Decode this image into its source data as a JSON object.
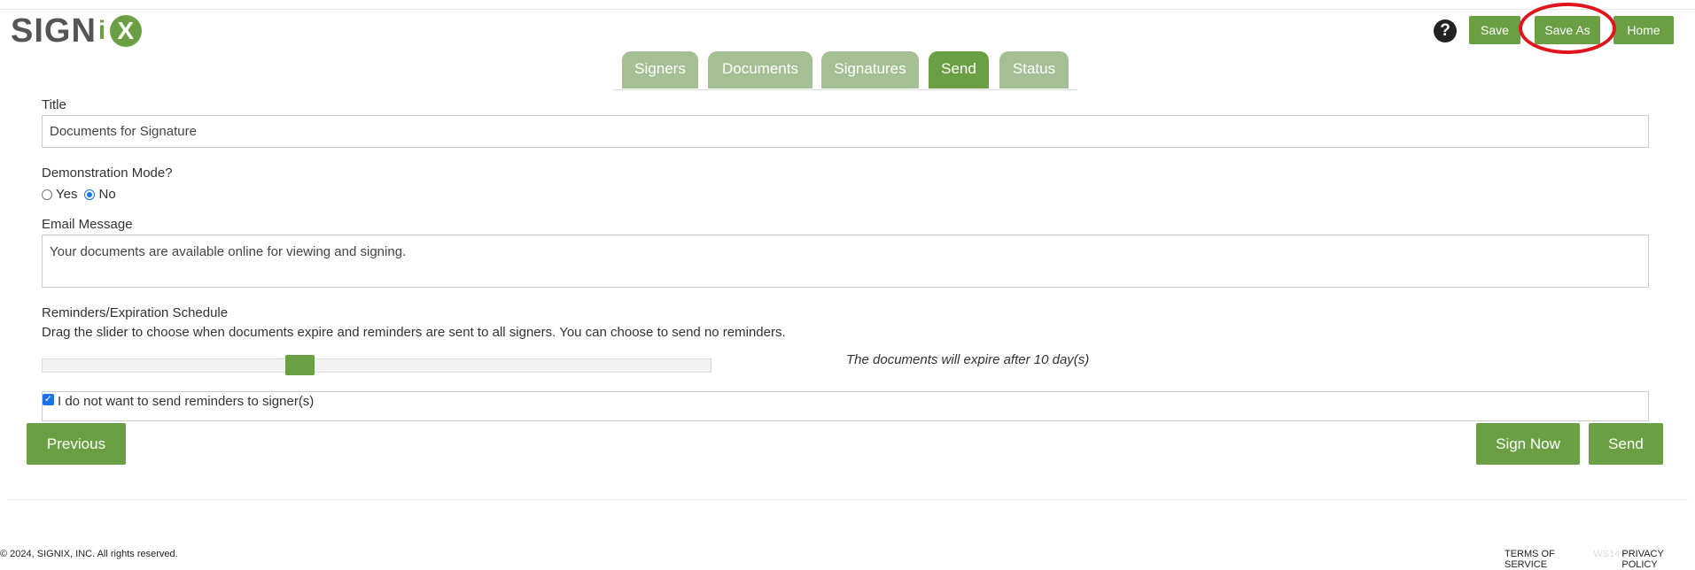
{
  "brand": {
    "logo_text_a": "SIGN",
    "logo_text_i": "i",
    "logo_text_x": "X",
    "accent_color": "#6aa043"
  },
  "header": {
    "help_label": "?",
    "save_label": "Save",
    "save_as_label": "Save As",
    "home_label": "Home",
    "highlight_color": "#e0151b"
  },
  "tabs": [
    {
      "label": "Signers",
      "active": false
    },
    {
      "label": "Documents",
      "active": false
    },
    {
      "label": "Signatures",
      "active": false
    },
    {
      "label": "Send",
      "active": true
    },
    {
      "label": "Status",
      "active": false
    }
  ],
  "form": {
    "title_label": "Title",
    "title_value": "Documents for Signature",
    "demo_label": "Demonstration Mode?",
    "demo_options": [
      {
        "label": "Yes",
        "checked": false
      },
      {
        "label": "No",
        "checked": true
      }
    ],
    "email_label": "Email Message",
    "email_value": "Your documents are available online for viewing and signing.",
    "reminders_label": "Reminders/Expiration Schedule",
    "reminders_desc": "Drag the slider to choose when documents expire and reminders are sent to all signers. You can choose to send no reminders.",
    "slider_position": 0.38,
    "expire_text": "The documents will expire after 10 day(s)",
    "no_reminders_label": "I do not want to send reminders to signer(s)",
    "no_reminders_checked": true
  },
  "actions": {
    "previous_label": "Previous",
    "sign_now_label": "Sign Now",
    "send_label": "Send"
  },
  "footer": {
    "copyright": "© 2024, SIGNIX, INC. All rights reserved.",
    "terms_label": "TERMS OF SERVICE",
    "version_label": "WS14",
    "privacy_label": "PRIVACY POLICY"
  }
}
